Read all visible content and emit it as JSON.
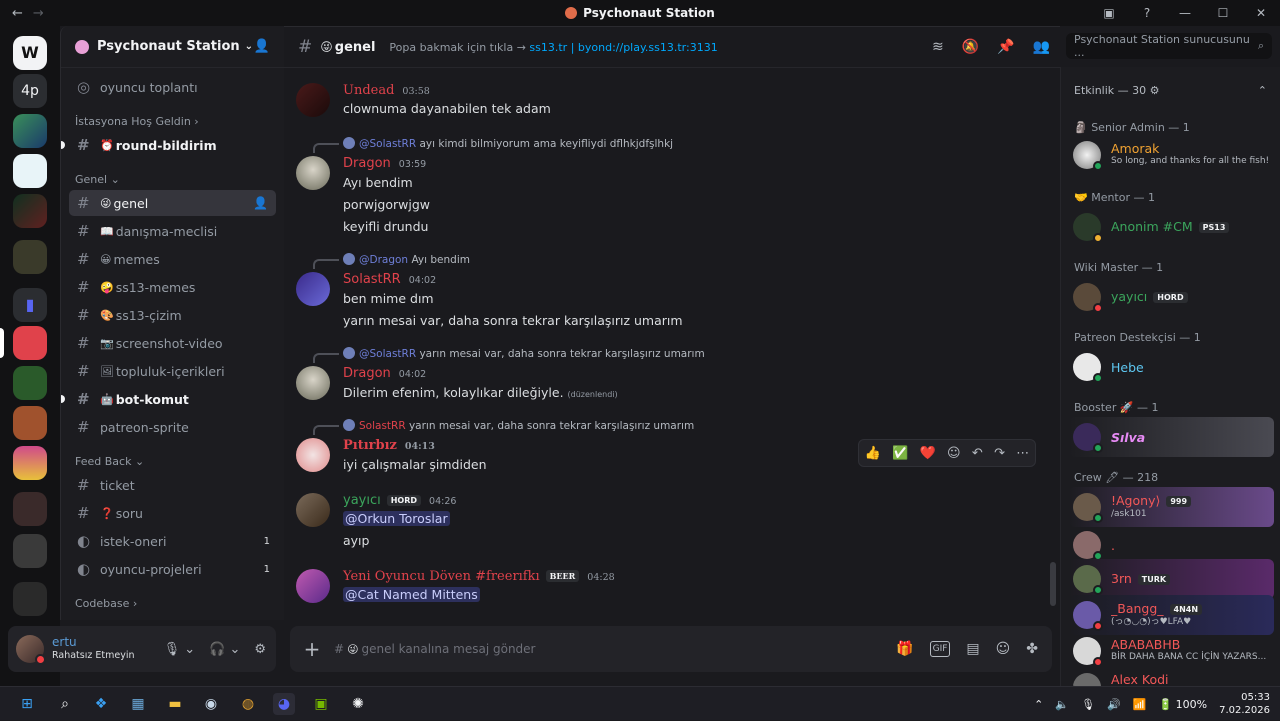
{
  "window": {
    "title": "Psychonaut Station",
    "back": "←",
    "forward": "→"
  },
  "server": {
    "name": "Psychonaut Station",
    "invite_icon": "add-person-icon"
  },
  "channels": [
    {
      "type": "voice",
      "label": "oyuncu toplantı"
    },
    {
      "type": "category",
      "label": "İstasyona Hoş Geldin ›"
    },
    {
      "type": "text",
      "emoji": "⏰",
      "label": "round-bildirim",
      "bold": true,
      "unread": true
    },
    {
      "type": "category",
      "label": "Genel ⌄"
    },
    {
      "type": "text",
      "emoji": "😜",
      "label": "genel",
      "active": true
    },
    {
      "type": "text",
      "emoji": "📖",
      "label": "danışma-meclisi"
    },
    {
      "type": "text",
      "emoji": "😀",
      "label": "memes"
    },
    {
      "type": "text",
      "emoji": "🤪",
      "label": "ss13-memes"
    },
    {
      "type": "text",
      "emoji": "🎨",
      "label": "ss13-çizim"
    },
    {
      "type": "text",
      "emoji": "📷",
      "label": "screenshot-video"
    },
    {
      "type": "text",
      "emoji": "🖼",
      "label": "topluluk-içerikleri"
    },
    {
      "type": "text",
      "emoji": "🤖",
      "label": "bot-komut",
      "bold": true,
      "unread": true
    },
    {
      "type": "text",
      "emoji": "",
      "label": "patreon-sprite"
    },
    {
      "type": "category",
      "label": "Feed Back ⌄"
    },
    {
      "type": "text",
      "emoji": "",
      "label": "ticket"
    },
    {
      "type": "text",
      "emoji": "❓",
      "label": "soru"
    },
    {
      "type": "forum",
      "emoji": "",
      "label": "istek-oneri",
      "count": "1"
    },
    {
      "type": "forum",
      "emoji": "",
      "label": "oyuncu-projeleri",
      "count": "1"
    },
    {
      "type": "category",
      "label": "Codebase ›"
    }
  ],
  "user": {
    "name": "ertu",
    "status": "Rahatsız Etmeyin"
  },
  "chat": {
    "channel": "genel",
    "channel_emoji": "😜",
    "topic_prefix": "Popa bakmak için tıkla → ",
    "topic_link": "ss13.tr | byond://play.ss13.tr:3131",
    "search_placeholder": "Psychonaut Station sunucusunu ...",
    "composer_placeholder": "genel kanalına mesaj gönder"
  },
  "messages": [
    {
      "user": "Undead",
      "color": "#e0424b",
      "time": "03:58",
      "lines": [
        "clownuma dayanabilen tek adam"
      ]
    },
    {
      "reply_to": "@SolastRR",
      "reply_text": "ayı kimdi bilmiyorum ama keyifliydi dflhkjdfşlhkj",
      "user": "Dragon",
      "color": "#e0424b",
      "time": "03:59",
      "lines": [
        "Ayı bendim",
        "porwjgorwjgw",
        "keyifli drundu"
      ]
    },
    {
      "reply_to": "@Dragon",
      "reply_text": "Ayı bendim",
      "user": "SolastRR",
      "color": "#e0424b",
      "time": "04:02",
      "lines": [
        "ben mime dım",
        "yarın mesai var, daha sonra tekrar karşılaşırız umarım"
      ]
    },
    {
      "reply_to": "@SolastRR",
      "reply_text": "yarın mesai var, daha sonra tekrar karşılaşırız umarım",
      "user": "Dragon",
      "color": "#e0424b",
      "time": "04:02",
      "lines": [
        "Dilerim efenim, kolaylıkar dileğiyle."
      ],
      "edited": "(düzenlendi)"
    },
    {
      "reply_to": "SolastRR",
      "reply_text": "yarın mesai var, daha sonra tekrar karşılaşırız umarım",
      "user": "Pıtırbız",
      "color": "#e0424b",
      "time": "04:13",
      "lines": [
        "iyi çalışmalar şimdiden"
      ]
    },
    {
      "user": "yayıcı",
      "color": "#3ba55c",
      "badge": "HORD",
      "time": "04:26",
      "mention": "@Orkun Toroslar",
      "lines": [
        "ayıp"
      ]
    },
    {
      "user": "Yeni Oyuncu Döven #freerıfkı",
      "color": "#e0424b",
      "badge": "BEER",
      "time": "04:28",
      "mention": "@Cat Named Mittens",
      "lines": []
    }
  ],
  "reactions": [
    "👍",
    "✅",
    "❤️",
    "☺",
    "↶",
    "↷",
    "⋯"
  ],
  "members": {
    "activity": "Etkinlik — 30",
    "groups": [
      {
        "label": "Senior Admin — 1",
        "emoji": "🗿"
      },
      {
        "label": "Mentor — 1",
        "emoji": "🤝"
      },
      {
        "label": "Wiki Master — 1",
        "emoji": ""
      },
      {
        "label": "Patreon Destekçisi — 1",
        "emoji": ""
      },
      {
        "label": "Booster 🚀 — 1",
        "emoji": ""
      },
      {
        "label": "Crew 🖊 — 218",
        "emoji": ""
      }
    ],
    "people": [
      {
        "name": "Amorak",
        "sub": "So long, and thanks for all the fish!",
        "color": "#f0a232"
      },
      {
        "name": "Anonim #CM",
        "badge": "PS13",
        "color": "#3ba55c"
      },
      {
        "name": "yayıcı",
        "badge": "HORD",
        "color": "#3ba55c"
      },
      {
        "name": "Hebe",
        "color": "#5ec8f2"
      },
      {
        "name": "Sılva",
        "color": "#e78bf5"
      },
      {
        "name": "!Agony⟩",
        "badge": "999",
        "sub": "/ask101",
        "color": "#f25858"
      },
      {
        "name": ".",
        "color": "#f25858"
      },
      {
        "name": "3rn",
        "badge": "TURK",
        "color": "#f25858"
      },
      {
        "name": "_Bangg_",
        "badge": "4N4N",
        "sub": "(っ◔◡◔)っ♥LFA♥",
        "color": "#f25858"
      },
      {
        "name": "ABABABHB",
        "sub": "BİR DAHA BANA CC İÇİN YAZARS...",
        "color": "#f25858"
      },
      {
        "name": "Alex Kodi",
        "color": "#f25858"
      }
    ]
  },
  "taskbar": {
    "battery": "100%",
    "time": "05:33",
    "date": "7.02.2026"
  }
}
